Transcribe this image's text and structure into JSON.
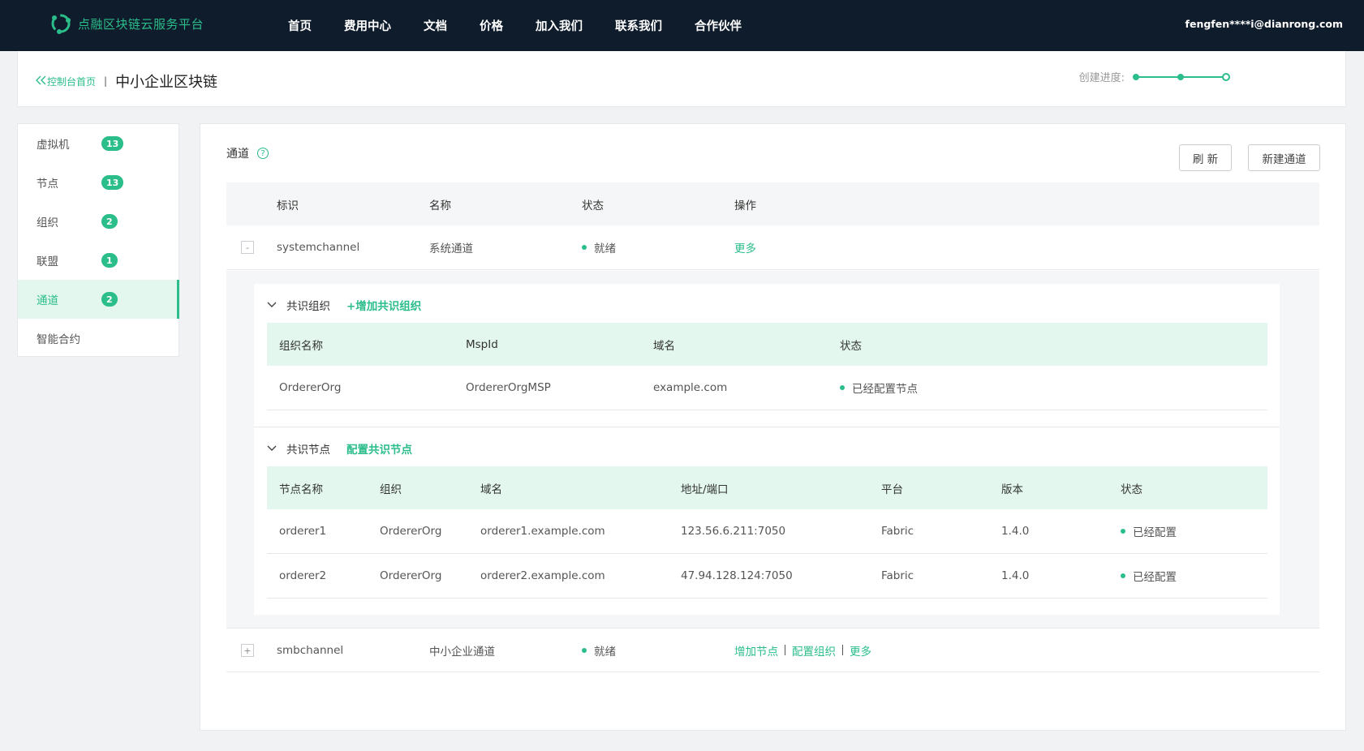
{
  "topbar": {
    "brand": "点融区块链云服务平台",
    "nav": [
      "首页",
      "费用中心",
      "文档",
      "价格",
      "加入我们",
      "联系我们",
      "合作伙伴"
    ],
    "user": "fengfen****i@dianrong.com"
  },
  "header": {
    "back_label": "控制台首页",
    "separator": "|",
    "title": "中小企业区块链",
    "progress_label": "创建进度:",
    "progress_steps_done": 3,
    "progress_steps_total": 3
  },
  "sidebar": {
    "items": [
      {
        "label": "虚拟机",
        "count": "13"
      },
      {
        "label": "节点",
        "count": "13"
      },
      {
        "label": "组织",
        "count": "2"
      },
      {
        "label": "联盟",
        "count": "1"
      },
      {
        "label": "通道",
        "count": "2",
        "active": true
      },
      {
        "label": "智能合约",
        "count": ""
      }
    ]
  },
  "main": {
    "section_title": "通道",
    "help_glyph": "?",
    "refresh_label": "刷 新",
    "new_label": "新建通道",
    "columns": [
      "标识",
      "名称",
      "状态",
      "操作"
    ],
    "channels": [
      {
        "toggle": "-",
        "id": "systemchannel",
        "name": "系统通道",
        "status": "就绪",
        "actions": [
          "更多"
        ]
      },
      {
        "toggle": "+",
        "id": "smbchannel",
        "name": "中小企业通道",
        "status": "就绪",
        "actions": [
          "增加节点",
          "配置组织",
          "更多"
        ]
      }
    ],
    "orgs_panel": {
      "title": "共识组织",
      "action": "+增加共识组织",
      "columns": [
        "组织名称",
        "MspId",
        "域名",
        "状态"
      ],
      "rows": [
        {
          "name": "OrdererOrg",
          "msp": "OrdererOrgMSP",
          "domain": "example.com",
          "status": "已经配置节点"
        }
      ]
    },
    "nodes_panel": {
      "title": "共识节点",
      "action": "配置共识节点",
      "columns": [
        "节点名称",
        "组织",
        "域名",
        "地址/端口",
        "平台",
        "版本",
        "状态"
      ],
      "rows": [
        {
          "name": "orderer1",
          "org": "OrdererOrg",
          "domain": "orderer1.example.com",
          "address": "123.56.6.211:7050",
          "platform": "Fabric",
          "version": "1.4.0",
          "status": "已经配置"
        },
        {
          "name": "orderer2",
          "org": "OrdererOrg",
          "domain": "orderer2.example.com",
          "address": "47.94.128.124:7050",
          "platform": "Fabric",
          "version": "1.4.0",
          "status": "已经配置"
        }
      ]
    }
  },
  "colors": {
    "accent": "#2bbd8a",
    "topbar": "#0f1c2c",
    "active_bg": "#e3f7ee"
  }
}
